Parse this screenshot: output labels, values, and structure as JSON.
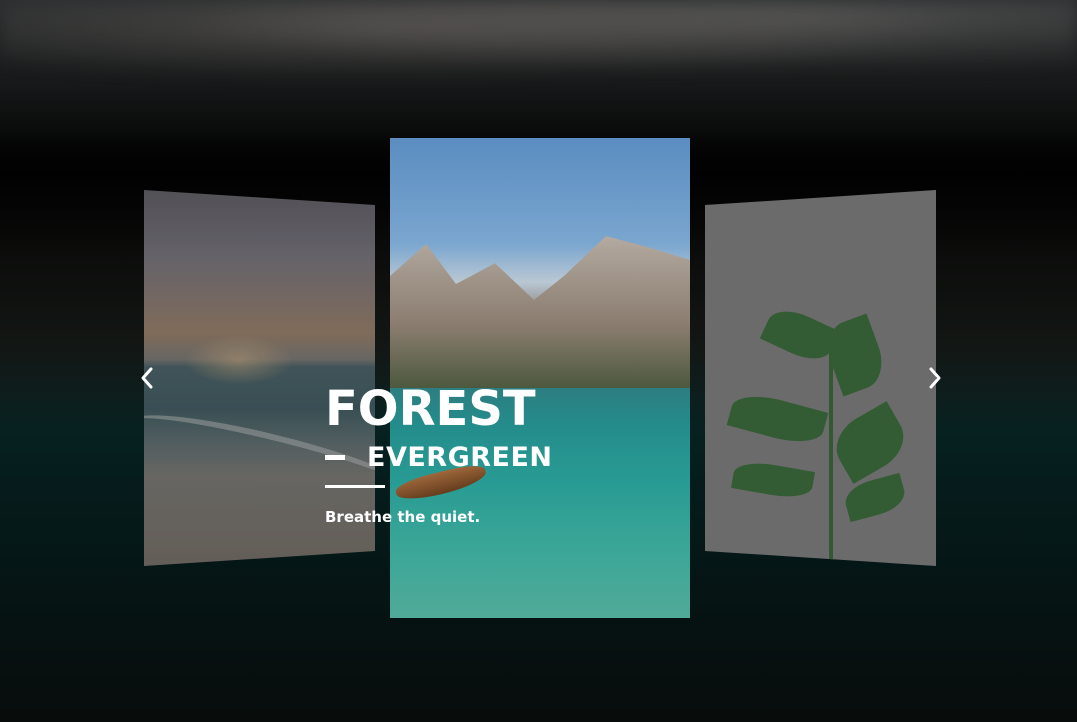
{
  "slide": {
    "title": "FOREST",
    "subtitle": "EVERGREEN",
    "tagline": "Breathe the quiet."
  },
  "controls": {
    "prev_icon": "chevron-left-icon",
    "next_icon": "chevron-right-icon"
  },
  "cards": {
    "left": "beach-sunset-image",
    "center": "mountain-lake-boat-image",
    "right": "plant-leaves-image"
  },
  "colors": {
    "text": "#ffffff",
    "lake": "#2aa29a"
  }
}
